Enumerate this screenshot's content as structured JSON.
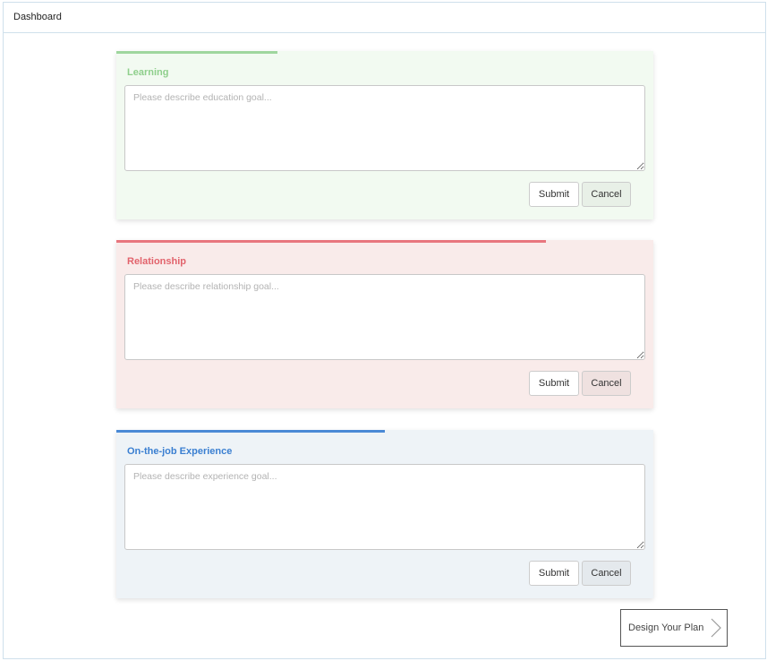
{
  "header": {
    "title": "Dashboard"
  },
  "cards": {
    "learning": {
      "label": "Learning",
      "placeholder": "Please describe education goal...",
      "progress": 0.3,
      "accent": "#9fd69e",
      "submit_label": "Submit",
      "cancel_label": "Cancel"
    },
    "relationship": {
      "label": "Relationship",
      "placeholder": "Please describe relationship goal...",
      "progress": 0.8,
      "accent": "#e8767e",
      "submit_label": "Submit",
      "cancel_label": "Cancel"
    },
    "experience": {
      "label": "On-the-job Experience",
      "placeholder": "Please describe experience goal...",
      "progress": 0.5,
      "accent": "#4a89d6",
      "submit_label": "Submit",
      "cancel_label": "Cancel"
    }
  },
  "footer": {
    "design_label": "Design Your Plan",
    "design_icon": "chevron-right-icon"
  }
}
